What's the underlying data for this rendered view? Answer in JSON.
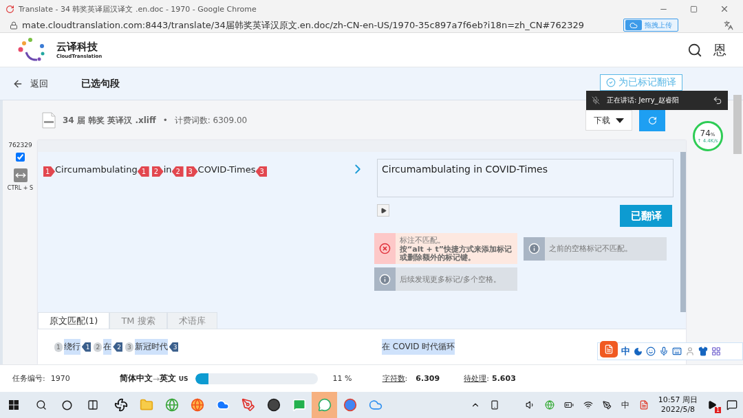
{
  "browser": {
    "title": "Translate - 34 韩奖英译届汉译文 .en.doc - 1970 - Google Chrome",
    "url": "mate.cloudtranslation.com:8443/translate/34届韩奖英译汉原文.en.doc/zh-CN-en-US/1970-35c897a7f6eb?i18n=zh_CN#762329",
    "extension_button": "拖拽上传"
  },
  "header": {
    "brand": "云译科技",
    "brand_sub": "CloudTranslation",
    "user": "恩"
  },
  "toolbar": {
    "back": "返回",
    "title": "已选句段",
    "action": "为已标记翻译"
  },
  "speaking": {
    "label": "正在讲话: Jerry_赵睿阳"
  },
  "file": {
    "name": "34 届 韩奖 英译汉 .xliff",
    "separator": "•",
    "word_count": "计费词数: 6309.00",
    "download": "下载"
  },
  "speed": {
    "value": "74",
    "unit": "%",
    "rate": "↑ 4.4K/s"
  },
  "segment": {
    "id": "762329",
    "checked": true,
    "shortcut": "CTRL + S",
    "source": [
      {
        "kind": "open",
        "text": "1"
      },
      {
        "kind": "text",
        "text": "Circumambulating"
      },
      {
        "kind": "close",
        "text": "1"
      },
      {
        "kind": "open",
        "text": "2"
      },
      {
        "kind": "text",
        "text": "in"
      },
      {
        "kind": "close",
        "text": "2"
      },
      {
        "kind": "open",
        "text": "3"
      },
      {
        "kind": "text",
        "text": "COVID-Times"
      },
      {
        "kind": "close",
        "text": "3"
      }
    ],
    "target": "Circumambulating in COVID-Times",
    "confirm": "已翻译",
    "messages": [
      {
        "kind": "error",
        "title": "标注不匹配。",
        "detail": "按“alt + t”快捷方式来添加标记或删除额外的标记键。"
      },
      {
        "kind": "info",
        "title": "之前的空格标记不匹配。"
      },
      {
        "kind": "info",
        "title": "后续发现更多标记/多个空格。"
      }
    ]
  },
  "tabs": [
    {
      "label": "原文匹配(1)",
      "selected": true
    },
    {
      "label": "TM 搜索",
      "selected": false
    },
    {
      "label": "术语库",
      "selected": false
    }
  ],
  "match": {
    "source": [
      {
        "kind": "open",
        "text": "1"
      },
      {
        "kind": "text",
        "text": "绕行"
      },
      {
        "kind": "close",
        "text": "1"
      },
      {
        "kind": "open",
        "text": "2"
      },
      {
        "kind": "text",
        "text": "在"
      },
      {
        "kind": "close",
        "text": "2"
      },
      {
        "kind": "open",
        "text": "3"
      },
      {
        "kind": "text",
        "text": "新冠时代"
      },
      {
        "kind": "close",
        "text": "3"
      }
    ],
    "target": "在 COVID 时代循环"
  },
  "status": {
    "task_label": "任务编号:",
    "task": "1970",
    "lang_from": "简体中文",
    "lang_arrow": "→",
    "lang_to": "英文",
    "lang_region": "US",
    "level": 0.11,
    "percent": "11 %",
    "chars_label": "字符数",
    "chars_colon": ":",
    "chars": "6.309",
    "pending_label": "待处理",
    "pending_colon": ":",
    "pending": "5.603"
  },
  "ime": {
    "lang": "中"
  },
  "taskbar": {
    "apps": [
      {
        "kind": "fan",
        "selected": false
      },
      {
        "kind": "folder",
        "selected": false
      },
      {
        "kind": "ie",
        "selected": false
      },
      {
        "kind": "firefox",
        "selected": false
      },
      {
        "kind": "cloud",
        "selected": false
      },
      {
        "kind": "pen",
        "selected": false
      },
      {
        "kind": "ghost",
        "selected": false
      },
      {
        "kind": "chat",
        "selected": false
      },
      {
        "kind": "wechat",
        "selected": true
      },
      {
        "kind": "chrome",
        "selected": false
      },
      {
        "kind": "baidu",
        "selected": false
      }
    ],
    "ime": "中",
    "time": "10:57 周日",
    "date": "2022/5/8",
    "badge": "1"
  }
}
